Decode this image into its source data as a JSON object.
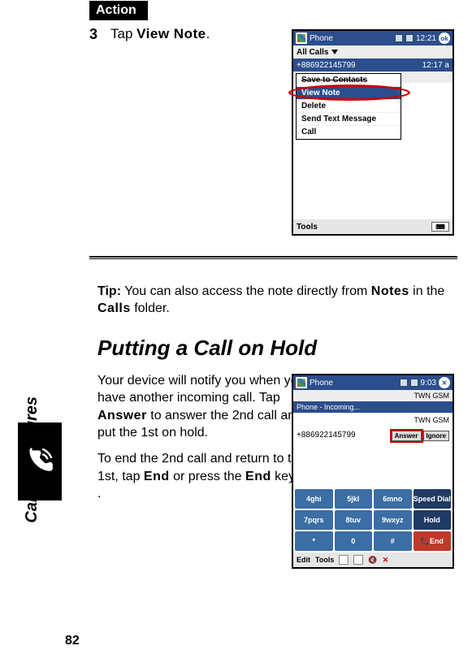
{
  "action_header": "Action",
  "step": {
    "num": "3",
    "text_pre": "Tap ",
    "bold": "View Note",
    "text_post": "."
  },
  "screen1": {
    "title": "Phone",
    "clock": "12:21",
    "ok": "ok",
    "allcalls": "All Calls",
    "number": "+886922145799",
    "time": "12:17 a",
    "menu": {
      "save": "Save to Contacts",
      "view_note": "View Note",
      "delete": "Delete",
      "send_text": "Send Text Message",
      "call": "Call"
    },
    "footer": "Tools",
    "kb": "⌨"
  },
  "tip": {
    "label": "Tip:",
    "t1": " You can also access the note directly from ",
    "notes": "Notes",
    "t2": " in the ",
    "calls": "Calls",
    "t3": " folder."
  },
  "section_heading": "Putting a Call on Hold",
  "side_label": "Calling Features",
  "hold": {
    "p1a": "Your device will notify you when you have another incoming call. Tap ",
    "p1b": "Answer",
    "p1c": " to answer the 2nd call and put the 1st on hold.",
    "p2a": "To end the 2nd call and return to the 1st, tap ",
    "p2b": "End",
    "p2c": " or press the ",
    "p2d": "End",
    "p2e": " key ",
    "keyglyph": "⏻",
    "p2f": "."
  },
  "screen2": {
    "title": "Phone",
    "clock": "9:03",
    "close": "✕",
    "twn": "TWN GSM",
    "banner": "Phone - Incoming...",
    "twn2": "TWN GSM",
    "number": "+886922145799",
    "answer": "Answer",
    "ignore": "Ignore",
    "keys": {
      "k4": "4ghi",
      "k5": "5jkl",
      "k6": "6mno",
      "speed": "Speed Dial",
      "k7": "7pqrs",
      "k8": "8tuv",
      "k9": "9wxyz",
      "hold": "Hold",
      "kstar": "*",
      "k0": "0",
      "khash": "#",
      "end": "End"
    },
    "footer_edit": "Edit",
    "footer_tools": "Tools",
    "footer_x": "✕"
  },
  "page_number": "82"
}
